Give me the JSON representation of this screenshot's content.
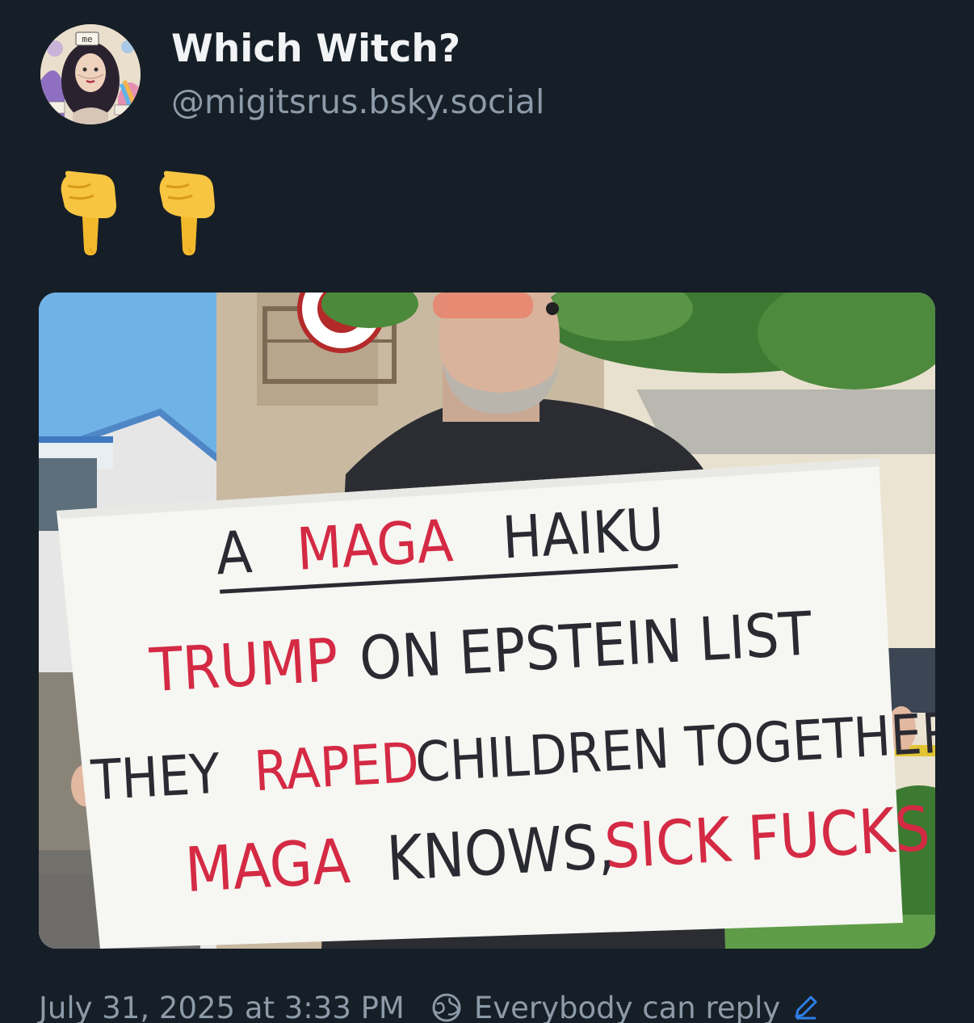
{
  "author": {
    "display_name": "Which Witch?",
    "handle": "@migitsrus.bsky.social",
    "avatar_icon": "avatar-illustration",
    "avatar_caption": "me"
  },
  "post": {
    "text_emojis": [
      "pointing-down-emoji",
      "pointing-down-emoji"
    ]
  },
  "media": {
    "sign": {
      "line1": [
        "A",
        "MAGA",
        "HAIKU"
      ],
      "line2": [
        "TRUMP",
        "ON EPSTEIN LIST"
      ],
      "line3": [
        "THEY",
        "RAPED",
        "CHILDREN TOGETHER"
      ],
      "line4": [
        "MAGA",
        "KNOWS,",
        "SICK FUCKS"
      ]
    },
    "colors": {
      "sign_red": "#d42a44",
      "sign_black": "#2a2a32"
    }
  },
  "footer": {
    "timestamp": "July 31, 2025 at 3:33 PM",
    "reply_setting": "Everybody can reply",
    "reply_icon": "globe-icon",
    "edit_icon": "pencil-icon"
  },
  "theme": {
    "background": "#161e27",
    "text_primary": "#f1f3f5",
    "text_secondary": "#8d9aa8",
    "accent": "#2f7ee6"
  }
}
